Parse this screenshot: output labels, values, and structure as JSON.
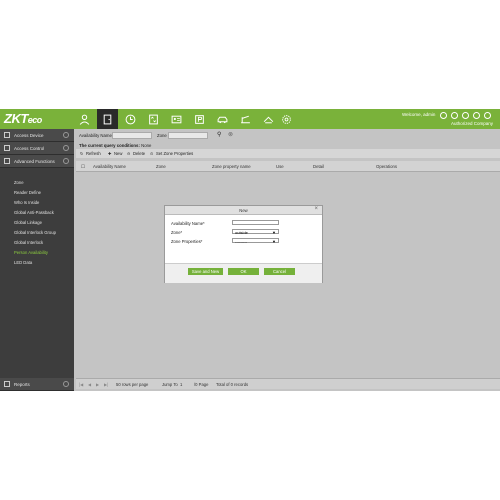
{
  "brand": {
    "logo_text": "ZKT",
    "logo_suffix": "eco"
  },
  "header": {
    "nav_icons": [
      "person-icon",
      "door-icon",
      "clock-icon",
      "elevator-icon",
      "camera-icon",
      "car-icon",
      "building-icon",
      "shield-icon",
      "gear-icon"
    ],
    "welcome": "Welcome, admin",
    "company": "Authorized Company"
  },
  "sidebar": {
    "sections": [
      {
        "label": "Access Device"
      },
      {
        "label": "Access Control"
      },
      {
        "label": "Advanced Functions"
      }
    ],
    "items": [
      {
        "label": "Zone"
      },
      {
        "label": "Reader Define"
      },
      {
        "label": "Who Is Inside"
      },
      {
        "label": "Global Anti-Passback"
      },
      {
        "label": "Global Linkage"
      },
      {
        "label": "Global Interlock Group"
      },
      {
        "label": "Global Interlock"
      },
      {
        "label": "Person Availability"
      },
      {
        "label": "LED Data"
      }
    ],
    "bottom": {
      "label": "Reports"
    }
  },
  "query": {
    "availability_label": "Availability Name",
    "zone_label": "Zone",
    "conditions_label": "The current query conditions:",
    "conditions_value": "None"
  },
  "toolbar": {
    "refresh": "Refresh",
    "new": "New",
    "delete": "Delete",
    "set_zone_properties": "Set Zone Properties"
  },
  "table": {
    "headers": [
      "Availability Name",
      "Zone",
      "Zone property name",
      "Use",
      "Detail",
      "Operations"
    ]
  },
  "pagination": {
    "rows_per_page": "50 rows per page",
    "jump_to": "Jump To",
    "page_value": "1",
    "page_suffix": "/0 Page",
    "total": "Total of 0 records"
  },
  "dialog": {
    "title": "New",
    "availability_name_label": "Availability Name*",
    "zone_label": "Zone*",
    "zone_value": "outside",
    "zone_properties_label": "Zone Properties*",
    "zone_properties_value": "---------",
    "save_and_new": "Save and New",
    "ok": "OK",
    "cancel": "Cancel"
  },
  "colors": {
    "accent": "#7ab23a",
    "sidebar": "#3d3d3d",
    "active_item": "#8ecf3f"
  }
}
